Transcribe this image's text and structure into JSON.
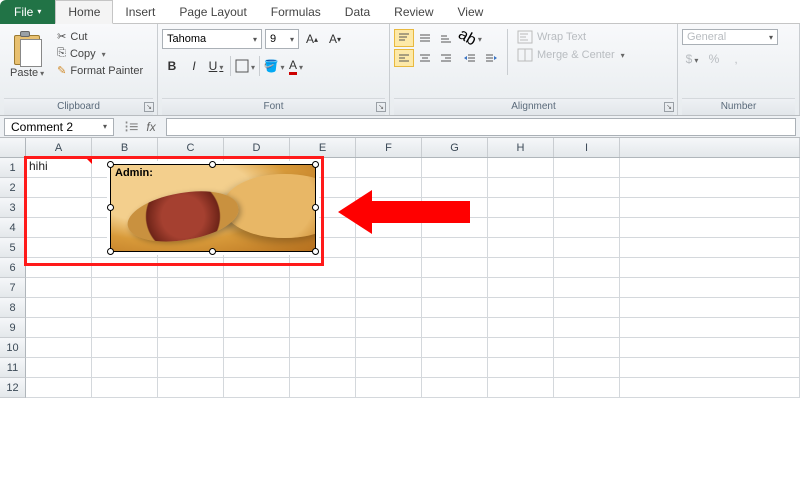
{
  "tabs": {
    "file": "File",
    "list": [
      "Home",
      "Insert",
      "Page Layout",
      "Formulas",
      "Data",
      "Review",
      "View"
    ],
    "active": "Home"
  },
  "clipboard": {
    "paste": "Paste",
    "cut": "Cut",
    "copy": "Copy",
    "fmt": "Format Painter",
    "group": "Clipboard"
  },
  "font": {
    "name": "Tahoma",
    "size": "9",
    "group": "Font",
    "bold": "B",
    "italic": "I",
    "underline": "U"
  },
  "alignment": {
    "wrap": "Wrap Text",
    "merge": "Merge & Center",
    "group": "Alignment"
  },
  "number": {
    "format": "General",
    "group": "Number",
    "currency": "$",
    "percent": "%",
    "comma": ","
  },
  "namebox": "Comment 2",
  "fx": "fx",
  "columns": [
    "A",
    "B",
    "C",
    "D",
    "E",
    "F",
    "G",
    "H",
    "I"
  ],
  "rows": [
    "1",
    "2",
    "3",
    "4",
    "5",
    "6",
    "7",
    "8",
    "9",
    "10",
    "11",
    "12"
  ],
  "cells": {
    "A1": "hihi"
  },
  "comment": {
    "author": "Admin:"
  }
}
